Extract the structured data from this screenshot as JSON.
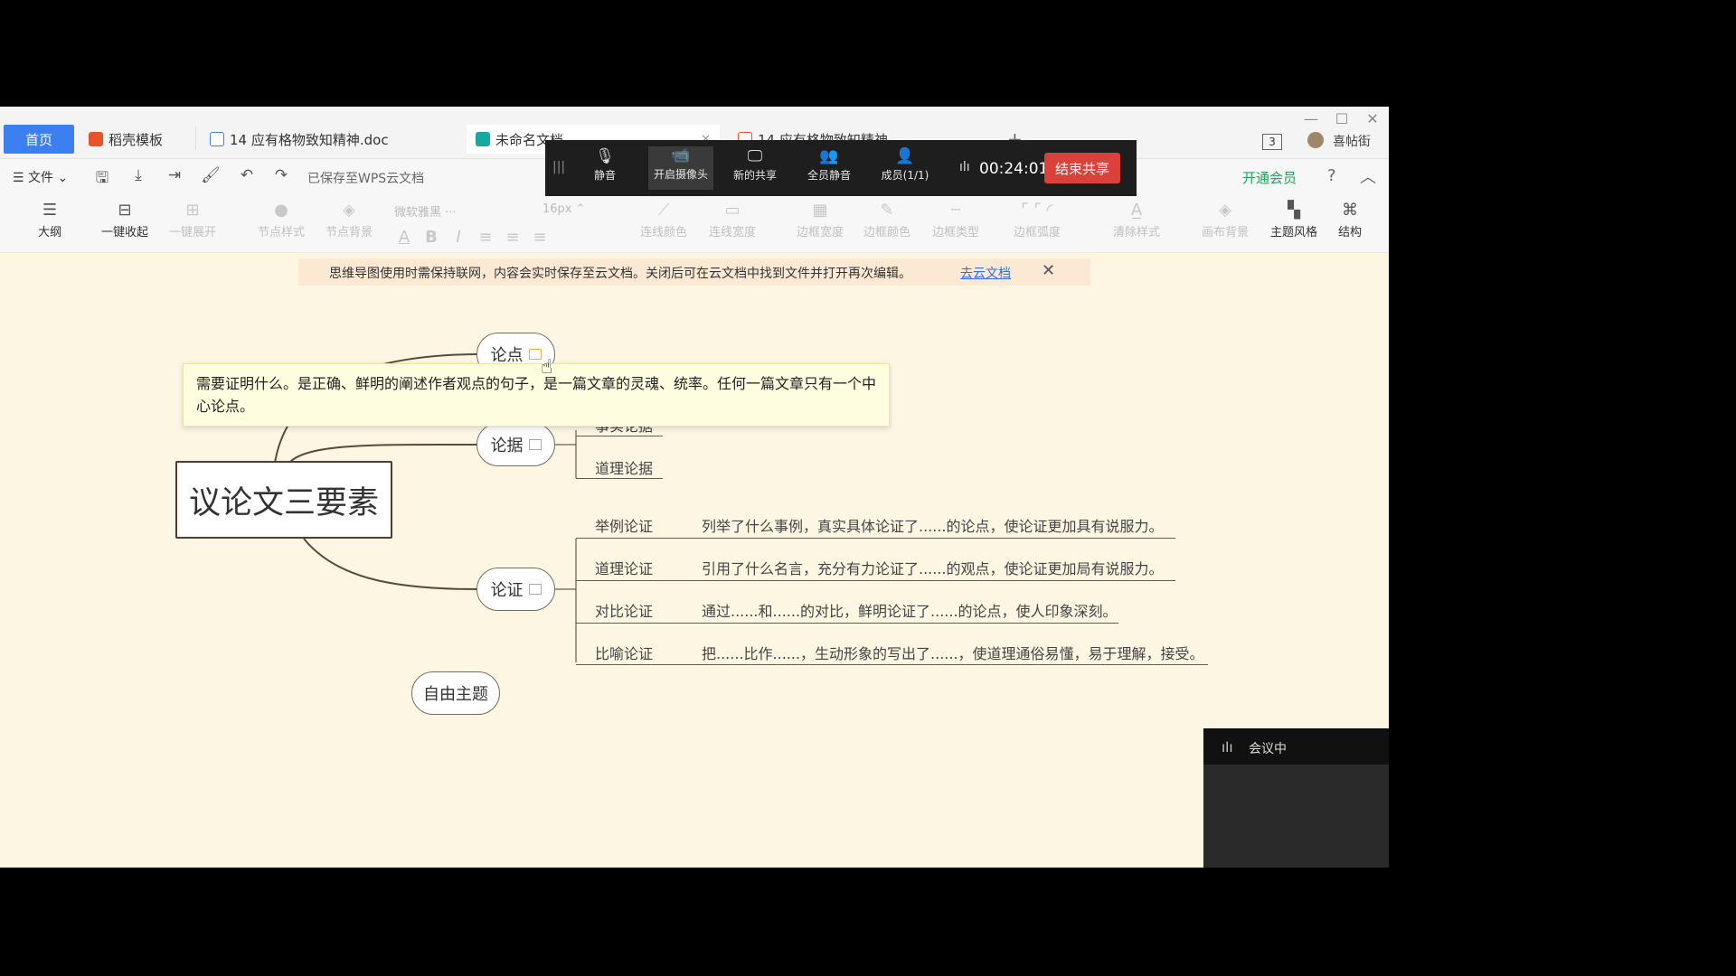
{
  "tabs": {
    "home": "首页",
    "template": "稻壳模板",
    "doc": "14 应有格物致知精神.doc",
    "mindmap": "未命名文档",
    "pdf": "14 应有格物致知精神"
  },
  "window": {
    "tab_count": "3",
    "user_name": "喜帖街"
  },
  "menubar": {
    "file": "文件",
    "saved_status": "已保存至WPS云文档",
    "vip": "开通会员"
  },
  "toolbar": {
    "outline": "大纲",
    "collapse_all": "一键收起",
    "expand_all": "一键展开",
    "node_style": "节点样式",
    "node_bg": "节点背景",
    "font": "微软雅黑",
    "font_size": "16px",
    "line_color": "连线颜色",
    "line_width": "连线宽度",
    "border_width": "边框宽度",
    "border_color": "边框颜色",
    "border_type": "边框类型",
    "border_radius": "边框弧度",
    "clear_style": "清除样式",
    "canvas_bg": "画布背景",
    "theme": "主题风格",
    "structure": "结构"
  },
  "notice": {
    "text": "思维导图使用时需保持联网，内容会实时保存至云文档。关闭后可在云文档中找到文件并打开再次编辑。",
    "link": "去云文档"
  },
  "meeting": {
    "mute": "静音",
    "camera": "开启摄像头",
    "share": "新的共享",
    "all_mute": "全员静音",
    "members": "成员(1/1)",
    "timer": "00:24:01",
    "end": "结束共享",
    "status": "会议中"
  },
  "mindmap": {
    "root": "议论文三要素",
    "node_thesis": "论点",
    "node_evidence": "论据",
    "node_argument": "论证",
    "node_free": "自由主题",
    "evidence_fact": "事实论据",
    "evidence_reason": "道理论据",
    "tooltip": "需要证明什么。是正确、鲜明的阐述作者观点的句子，是一篇文章的灵魂、统率。任何一篇文章只有一个中心论点。",
    "methods": [
      {
        "name": "举例论证",
        "desc": "列举了什么事例，真实具体论证了......的论点，使论证更加具有说服力。"
      },
      {
        "name": "道理论证",
        "desc": "引用了什么名言，充分有力论证了......的观点，使论证更加局有说服力。"
      },
      {
        "name": "对比论证",
        "desc": "通过......和......的对比，鲜明论证了......的论点，使人印象深刻。"
      },
      {
        "name": "比喻论证",
        "desc": "把......比作......，生动形象的写出了......，使道理通俗易懂，易于理解，接受。"
      }
    ]
  }
}
